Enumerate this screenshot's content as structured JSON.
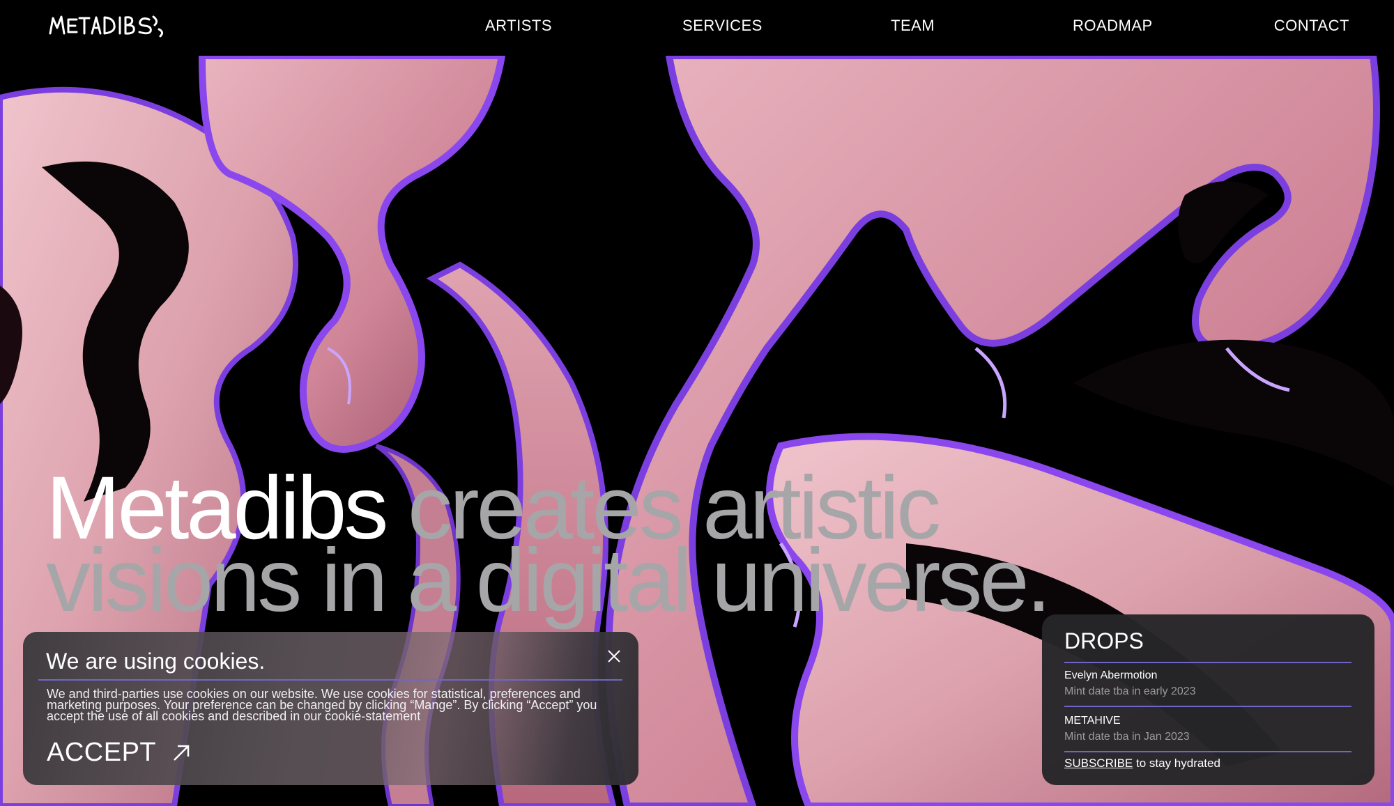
{
  "header": {
    "logo_text": "METADIBS",
    "nav": [
      "ARTISTS",
      "SERVICES",
      "TEAM",
      "ROADMAP",
      "CONTACT"
    ]
  },
  "hero": {
    "headline_strong": "Metadibs",
    "headline_rest": "creates artistic visions in a digital universe."
  },
  "cookie": {
    "title": "We are using cookies.",
    "body": "We and third-parties use cookies on our website. We use cookies for statistical, preferences and marketing purposes. Your preference can be changed by clicking “Mange”. By clicking “Accept” you accept the use of all cookies and described in our cookie-statement",
    "accept_label": "ACCEPT"
  },
  "drops": {
    "title": "DROPS",
    "items": [
      {
        "name": "Evelyn Abermotion",
        "date": "Mint date tba in early 2023"
      },
      {
        "name": "METAHIVE",
        "date": "Mint date tba in Jan 2023"
      }
    ],
    "subscribe_link": "SUBSCRIBE",
    "subscribe_text": "to stay hydrated"
  },
  "colors": {
    "accent_line": "#6e67c8",
    "muted_text": "#a6a6a8",
    "hero_pink": "#d7909f",
    "hero_violet": "#7b3fe0"
  }
}
